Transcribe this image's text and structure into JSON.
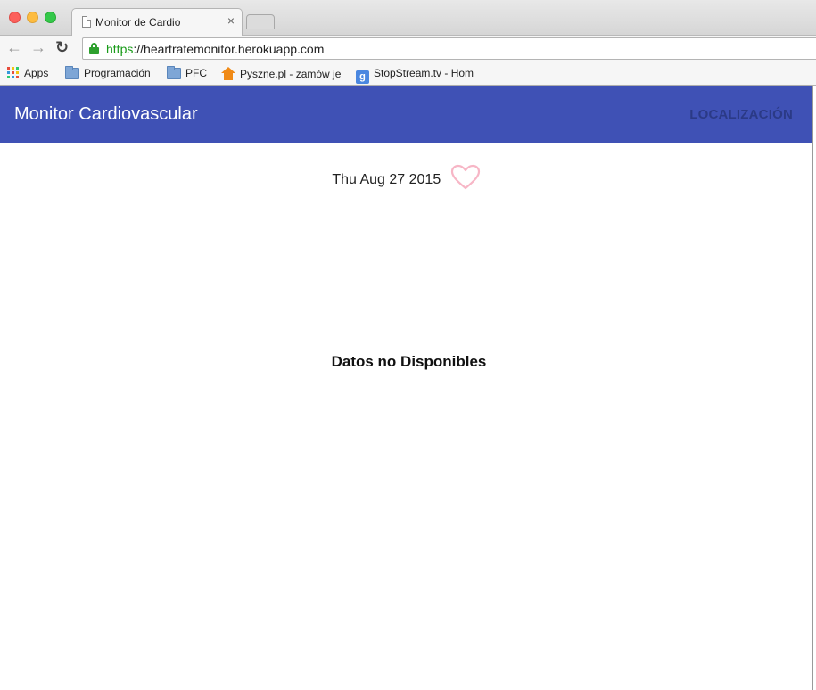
{
  "browser": {
    "tab_title": "Monitor de Cardio",
    "tab_close": "×",
    "url_scheme": "https",
    "url_rest": "://heartratemonitor.herokuapp.com",
    "bookmarks": [
      {
        "label": "Apps",
        "icon": "apps-grid-icon"
      },
      {
        "label": "Programación",
        "icon": "folder-icon"
      },
      {
        "label": "PFC",
        "icon": "folder-icon"
      },
      {
        "label": "Pyszne.pl - zamów je",
        "icon": "pyszne-house-icon"
      },
      {
        "label": "StopStream.tv - Hom",
        "icon": "google-icon"
      }
    ]
  },
  "app": {
    "title": "Monitor Cardiovascular",
    "nav_localizacion": "LOCALIZACIÓN",
    "date": "Thu Aug 27 2015",
    "heart_icon": "heart-outline-icon",
    "no_data": "Datos no Disponibles",
    "colors": {
      "appbar": "#3f51b5",
      "heart": "#f7b6c6"
    }
  }
}
